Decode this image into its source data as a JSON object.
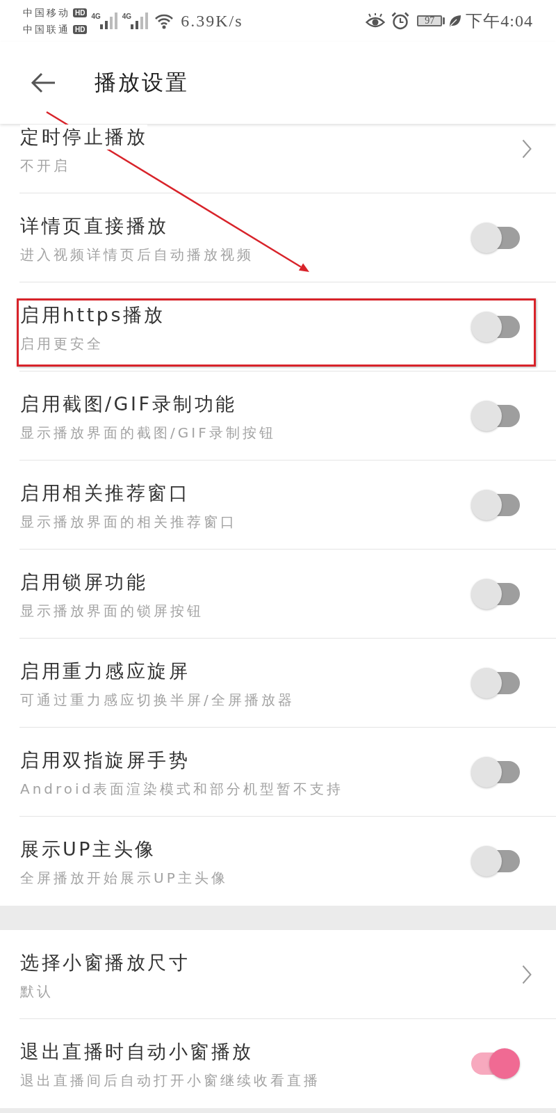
{
  "status_bar": {
    "carriers": [
      {
        "name": "中国移动",
        "badge": "HD"
      },
      {
        "name": "中国联通",
        "badge": "HD"
      }
    ],
    "networks": [
      {
        "type": "4G"
      },
      {
        "type": "4G"
      }
    ],
    "speed": "6.39K/s",
    "battery": "97",
    "time": "下午4:04"
  },
  "header": {
    "title": "播放设置"
  },
  "sections": [
    {
      "items": [
        {
          "kind": "link",
          "title": "定时停止播放",
          "subtitle": "不开启",
          "highlighted": false
        },
        {
          "kind": "switch",
          "title": "详情页直接播放",
          "subtitle": "进入视频详情页后自动播放视频",
          "on": false,
          "highlighted": false
        },
        {
          "kind": "switch",
          "title": "启用https播放",
          "subtitle": "启用更安全",
          "on": false,
          "highlighted": true
        },
        {
          "kind": "switch",
          "title": "启用截图/GIF录制功能",
          "subtitle": "显示播放界面的截图/GIF录制按钮",
          "on": false,
          "highlighted": false
        },
        {
          "kind": "switch",
          "title": "启用相关推荐窗口",
          "subtitle": "显示播放界面的相关推荐窗口",
          "on": false,
          "highlighted": false
        },
        {
          "kind": "switch",
          "title": "启用锁屏功能",
          "subtitle": "显示播放界面的锁屏按钮",
          "on": false,
          "highlighted": false
        },
        {
          "kind": "switch",
          "title": "启用重力感应旋屏",
          "subtitle": "可通过重力感应切换半屏/全屏播放器",
          "on": false,
          "highlighted": false
        },
        {
          "kind": "switch",
          "title": "启用双指旋屏手势",
          "subtitle": "Android表面渲染模式和部分机型暂不支持",
          "on": false,
          "highlighted": false
        },
        {
          "kind": "switch",
          "title": "展示UP主头像",
          "subtitle": "全屏播放开始展示UP主头像",
          "on": false,
          "highlighted": false
        }
      ]
    },
    {
      "items": [
        {
          "kind": "link",
          "title": "选择小窗播放尺寸",
          "subtitle": "默认",
          "highlighted": false
        },
        {
          "kind": "switch",
          "title": "退出直播时自动小窗播放",
          "subtitle": "退出直播间后自动打开小窗继续收看直播",
          "on": true,
          "highlighted": false
        }
      ]
    }
  ]
}
